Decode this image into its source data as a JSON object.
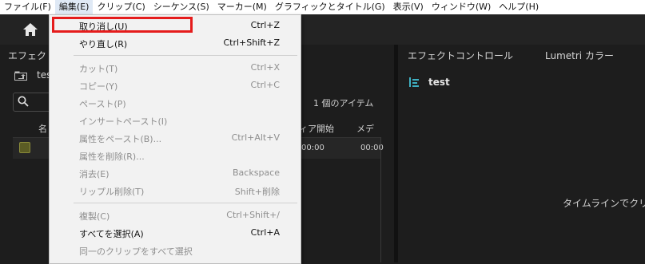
{
  "menubar": {
    "items": [
      {
        "label": "ファイル(F)"
      },
      {
        "label": "編集(E)"
      },
      {
        "label": "クリップ(C)"
      },
      {
        "label": "シーケンス(S)"
      },
      {
        "label": "マーカー(M)"
      },
      {
        "label": "グラフィックとタイトル(G)"
      },
      {
        "label": "表示(V)"
      },
      {
        "label": "ウィンドウ(W)"
      },
      {
        "label": "ヘルプ(H)"
      }
    ]
  },
  "left_panel": {
    "title": "エフェク",
    "project": "tes",
    "item_count": "1 個のアイテム",
    "col_name": "名",
    "col_start": "ィア開始",
    "col_media": "メデ",
    "row_time1": "00:00",
    "row_time2": "00:00"
  },
  "right_panel": {
    "tab_effect_controls": "エフェクトコントロール",
    "tab_lumetri": "Lumetri カラー",
    "sequence_name": "test",
    "message": "タイムラインでクリ"
  },
  "edit_menu": {
    "items": [
      {
        "label": "取り消し(U)",
        "shortcut": "Ctrl+Z"
      },
      {
        "label": "やり直し(R)",
        "shortcut": "Ctrl+Shift+Z"
      },
      {
        "label": "カット(T)",
        "shortcut": "Ctrl+X"
      },
      {
        "label": "コピー(Y)",
        "shortcut": "Ctrl+C"
      },
      {
        "label": "ペースト(P)",
        "shortcut": ""
      },
      {
        "label": "インサートペースト(I)",
        "shortcut": ""
      },
      {
        "label": "属性をペースト(B)...",
        "shortcut": "Ctrl+Alt+V"
      },
      {
        "label": "属性を削除(R)...",
        "shortcut": ""
      },
      {
        "label": "消去(E)",
        "shortcut": "Backspace"
      },
      {
        "label": "リップル削除(T)",
        "shortcut": "Shift+削除"
      },
      {
        "label": "複製(C)",
        "shortcut": "Ctrl+Shift+/"
      },
      {
        "label": "すべてを選択(A)",
        "shortcut": "Ctrl+A"
      },
      {
        "label": "同一のクリップをすべて選択",
        "shortcut": ""
      }
    ]
  },
  "colors": {
    "highlight": "#e51c1c",
    "background": "#1d1d1d",
    "menu_bg": "#f2f2f2",
    "disabled_text": "#8e8e8e"
  }
}
